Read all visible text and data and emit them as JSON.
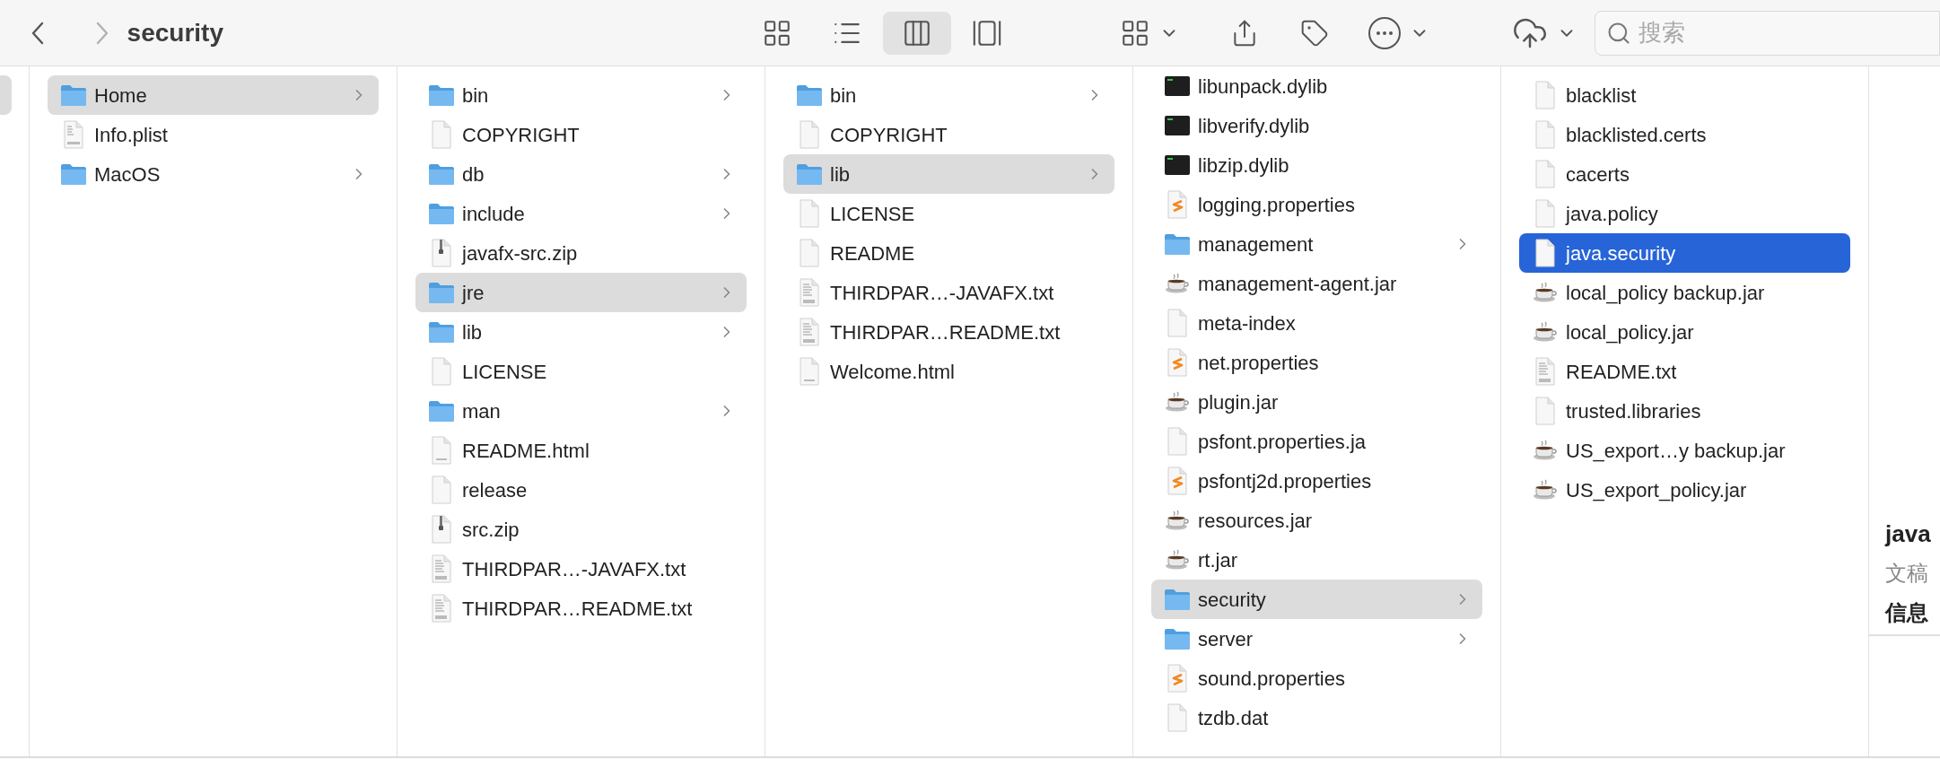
{
  "toolbar": {
    "back_enabled": true,
    "forward_enabled": false,
    "title": "security",
    "view_modes": [
      {
        "kind": "icons",
        "selected": false
      },
      {
        "kind": "list",
        "selected": false
      },
      {
        "kind": "columns",
        "selected": true
      },
      {
        "kind": "gallery",
        "selected": false
      }
    ],
    "search": {
      "placeholder": "搜索"
    }
  },
  "columns": [
    {
      "focused": false,
      "scrolled": false,
      "items": [
        {
          "name": "Home",
          "kind": "folder",
          "selected": true
        },
        {
          "name": "Info.plist",
          "kind": "plist",
          "selected": false
        },
        {
          "name": "MacOS",
          "kind": "folder",
          "selected": false
        }
      ]
    },
    {
      "focused": false,
      "scrolled": false,
      "items": [
        {
          "name": "bin",
          "kind": "folder",
          "selected": false
        },
        {
          "name": "COPYRIGHT",
          "kind": "file",
          "selected": false
        },
        {
          "name": "db",
          "kind": "folder",
          "selected": false
        },
        {
          "name": "include",
          "kind": "folder",
          "selected": false
        },
        {
          "name": "javafx-src.zip",
          "kind": "zip",
          "selected": false
        },
        {
          "name": "jre",
          "kind": "folder",
          "selected": true
        },
        {
          "name": "lib",
          "kind": "folder",
          "selected": false
        },
        {
          "name": "LICENSE",
          "kind": "file",
          "selected": false
        },
        {
          "name": "man",
          "kind": "folder",
          "selected": false
        },
        {
          "name": "README.html",
          "kind": "html",
          "selected": false
        },
        {
          "name": "release",
          "kind": "file",
          "selected": false
        },
        {
          "name": "src.zip",
          "kind": "zip",
          "selected": false
        },
        {
          "name": "THIRDPAR…-JAVAFX.txt",
          "kind": "txt",
          "selected": false
        },
        {
          "name": "THIRDPAR…README.txt",
          "kind": "txt",
          "selected": false
        }
      ]
    },
    {
      "focused": false,
      "scrolled": false,
      "items": [
        {
          "name": "bin",
          "kind": "folder",
          "selected": false
        },
        {
          "name": "COPYRIGHT",
          "kind": "file",
          "selected": false
        },
        {
          "name": "lib",
          "kind": "folder",
          "selected": true
        },
        {
          "name": "LICENSE",
          "kind": "file",
          "selected": false
        },
        {
          "name": "README",
          "kind": "file",
          "selected": false
        },
        {
          "name": "THIRDPAR…-JAVAFX.txt",
          "kind": "txt",
          "selected": false
        },
        {
          "name": "THIRDPAR…README.txt",
          "kind": "txt",
          "selected": false
        },
        {
          "name": "Welcome.html",
          "kind": "html",
          "selected": false
        }
      ]
    },
    {
      "focused": false,
      "scrolled": true,
      "items": [
        {
          "name": "libunpack.dylib",
          "kind": "exec",
          "selected": false
        },
        {
          "name": "libverify.dylib",
          "kind": "exec",
          "selected": false
        },
        {
          "name": "libzip.dylib",
          "kind": "exec",
          "selected": false
        },
        {
          "name": "logging.properties",
          "kind": "props",
          "selected": false
        },
        {
          "name": "management",
          "kind": "folder",
          "selected": false
        },
        {
          "name": "management-agent.jar",
          "kind": "jar",
          "selected": false
        },
        {
          "name": "meta-index",
          "kind": "file",
          "selected": false
        },
        {
          "name": "net.properties",
          "kind": "props",
          "selected": false
        },
        {
          "name": "plugin.jar",
          "kind": "jar",
          "selected": false
        },
        {
          "name": "psfont.properties.ja",
          "kind": "file",
          "selected": false
        },
        {
          "name": "psfontj2d.properties",
          "kind": "props",
          "selected": false
        },
        {
          "name": "resources.jar",
          "kind": "jar",
          "selected": false
        },
        {
          "name": "rt.jar",
          "kind": "jar",
          "selected": false
        },
        {
          "name": "security",
          "kind": "folder",
          "selected": true
        },
        {
          "name": "server",
          "kind": "folder",
          "selected": false
        },
        {
          "name": "sound.properties",
          "kind": "props",
          "selected": false
        },
        {
          "name": "tzdb.dat",
          "kind": "file",
          "selected": false
        }
      ]
    },
    {
      "focused": true,
      "scrolled": false,
      "items": [
        {
          "name": "blacklist",
          "kind": "file",
          "selected": false
        },
        {
          "name": "blacklisted.certs",
          "kind": "file",
          "selected": false
        },
        {
          "name": "cacerts",
          "kind": "file",
          "selected": false
        },
        {
          "name": "java.policy",
          "kind": "file",
          "selected": false
        },
        {
          "name": "java.security",
          "kind": "file",
          "selected": true
        },
        {
          "name": "local_policy backup.jar",
          "kind": "jar",
          "selected": false
        },
        {
          "name": "local_policy.jar",
          "kind": "jar",
          "selected": false
        },
        {
          "name": "README.txt",
          "kind": "txt",
          "selected": false
        },
        {
          "name": "trusted.libraries",
          "kind": "file",
          "selected": false
        },
        {
          "name": "US_export…y backup.jar",
          "kind": "jar",
          "selected": false
        },
        {
          "name": "US_export_policy.jar",
          "kind": "jar",
          "selected": false
        }
      ]
    }
  ],
  "preview": {
    "title": "java",
    "kind_label": "文稿",
    "section": "信息"
  }
}
